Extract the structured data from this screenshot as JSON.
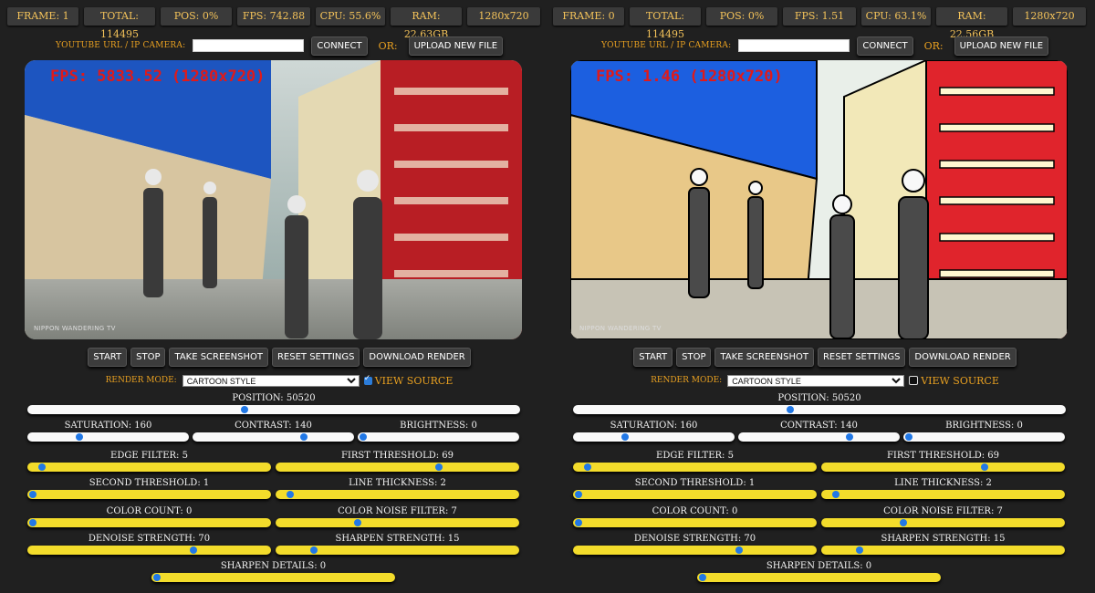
{
  "panels": [
    {
      "stats": [
        {
          "label": "FRAME: 1"
        },
        {
          "label": "TOTAL: 114495"
        },
        {
          "label": "POS: 0%"
        },
        {
          "label": "FPS: 742.88"
        },
        {
          "label": "CPU: 55.6%"
        },
        {
          "label": "RAM: 22.63GB"
        },
        {
          "label": "1280x720"
        }
      ],
      "url_label": "YOUTUBE URL / IP CAMERA:",
      "url_value": "",
      "connect_label": "CONNECT",
      "or_label": "OR:",
      "upload_label": "UPLOAD NEW FILE",
      "video_overlay": "FPS: 5833.52 (1280x720)",
      "watermark": "NIPPON WANDERING TV",
      "controls": [
        "START",
        "STOP",
        "TAKE SCREENSHOT",
        "RESET SETTINGS",
        "DOWNLOAD RENDER"
      ],
      "render_mode_label": "RENDER MODE:",
      "render_mode_value": "CARTOON STYLE",
      "view_source_label": "VIEW SOURCE",
      "view_source_checked": true,
      "sliders": {
        "position": {
          "label": "POSITION: 50520",
          "fraction": 0.44
        },
        "saturation": {
          "label": "SATURATION: 160",
          "fraction": 0.31
        },
        "contrast": {
          "label": "CONTRAST: 140",
          "fraction": 0.7
        },
        "brightness": {
          "label": "BRIGHTNESS: 0",
          "fraction": 0.0
        },
        "edge_filter": {
          "label": "EDGE FILTER: 5",
          "fraction": 0.04
        },
        "first_threshold": {
          "label": "FIRST THRESHOLD: 69",
          "fraction": 0.68
        },
        "second_threshold": {
          "label": "SECOND THRESHOLD: 1",
          "fraction": 0.0
        },
        "line_thickness": {
          "label": "LINE THICKNESS: 2",
          "fraction": 0.04
        },
        "color_count": {
          "label": "COLOR COUNT: 0",
          "fraction": 0.0
        },
        "color_noise_filter": {
          "label": "COLOR NOISE FILTER: 7",
          "fraction": 0.33
        },
        "denoise_strength": {
          "label": "DENOISE STRENGTH: 70",
          "fraction": 0.69
        },
        "sharpen_strength": {
          "label": "SHARPEN STRENGTH: 15",
          "fraction": 0.14
        },
        "sharpen_details": {
          "label": "SHARPEN DETAILS: 0",
          "fraction": 0.0
        }
      }
    },
    {
      "stats": [
        {
          "label": "FRAME: 0"
        },
        {
          "label": "TOTAL: 114495"
        },
        {
          "label": "POS: 0%"
        },
        {
          "label": "FPS: 1.51"
        },
        {
          "label": "CPU: 63.1%"
        },
        {
          "label": "RAM: 22.56GB"
        },
        {
          "label": "1280x720"
        }
      ],
      "url_label": "YOUTUBE URL / IP CAMERA:",
      "url_value": "",
      "connect_label": "CONNECT",
      "or_label": "OR:",
      "upload_label": "UPLOAD NEW FILE",
      "video_overlay": "FPS: 1.46 (1280x720)",
      "watermark": "NIPPON WANDERING TV",
      "controls": [
        "START",
        "STOP",
        "TAKE SCREENSHOT",
        "RESET SETTINGS",
        "DOWNLOAD RENDER"
      ],
      "render_mode_label": "RENDER MODE:",
      "render_mode_value": "CARTOON STYLE",
      "view_source_label": "VIEW SOURCE",
      "view_source_checked": false,
      "sliders": {
        "position": {
          "label": "POSITION: 50520",
          "fraction": 0.44
        },
        "saturation": {
          "label": "SATURATION: 160",
          "fraction": 0.31
        },
        "contrast": {
          "label": "CONTRAST: 140",
          "fraction": 0.7
        },
        "brightness": {
          "label": "BRIGHTNESS: 0",
          "fraction": 0.0
        },
        "edge_filter": {
          "label": "EDGE FILTER: 5",
          "fraction": 0.04
        },
        "first_threshold": {
          "label": "FIRST THRESHOLD: 69",
          "fraction": 0.68
        },
        "second_threshold": {
          "label": "SECOND THRESHOLD: 1",
          "fraction": 0.0
        },
        "line_thickness": {
          "label": "LINE THICKNESS: 2",
          "fraction": 0.04
        },
        "color_count": {
          "label": "COLOR COUNT: 0",
          "fraction": 0.0
        },
        "color_noise_filter": {
          "label": "COLOR NOISE FILTER: 7",
          "fraction": 0.33
        },
        "denoise_strength": {
          "label": "DENOISE STRENGTH: 70",
          "fraction": 0.69
        },
        "sharpen_strength": {
          "label": "SHARPEN STRENGTH: 15",
          "fraction": 0.14
        },
        "sharpen_details": {
          "label": "SHARPEN DETAILS: 0",
          "fraction": 0.0
        }
      }
    }
  ],
  "colors": {
    "accent": "#e8a020",
    "track_yellow": "#f3dc2b",
    "thumb": "#2178e6",
    "background": "#202020"
  }
}
